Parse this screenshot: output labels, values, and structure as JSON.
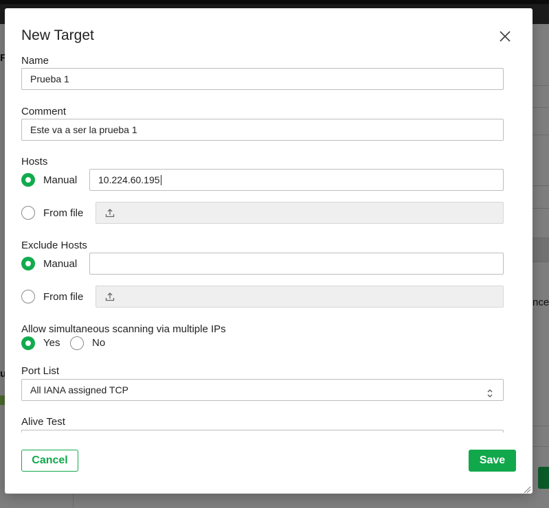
{
  "dialog": {
    "title": "New Target",
    "close_icon": "close-icon"
  },
  "form": {
    "name": {
      "label": "Name",
      "value": "Prueba 1"
    },
    "comment": {
      "label": "Comment",
      "value": "Este va a ser la prueba 1"
    },
    "hosts": {
      "label": "Hosts",
      "manual_label": "Manual",
      "manual_value": "10.224.60.195",
      "from_file_label": "From file",
      "selected": "manual"
    },
    "exclude_hosts": {
      "label": "Exclude Hosts",
      "manual_label": "Manual",
      "manual_value": "",
      "from_file_label": "From file",
      "selected": "manual"
    },
    "simultaneous": {
      "label": "Allow simultaneous scanning via multiple IPs",
      "yes_label": "Yes",
      "no_label": "No",
      "selected": "yes"
    },
    "port_list": {
      "label": "Port List",
      "value": "All IANA assigned TCP"
    },
    "alive_test": {
      "label": "Alive Test"
    }
  },
  "footer": {
    "cancel_label": "Cancel",
    "save_label": "Save"
  },
  "background": {
    "fragment_f": "F",
    "fragment_u": "u",
    "fragment_nce": "nce"
  },
  "colors": {
    "accent": "#11a84c",
    "overlay": "#7f7f7f",
    "disabled_field": "#efefef"
  }
}
